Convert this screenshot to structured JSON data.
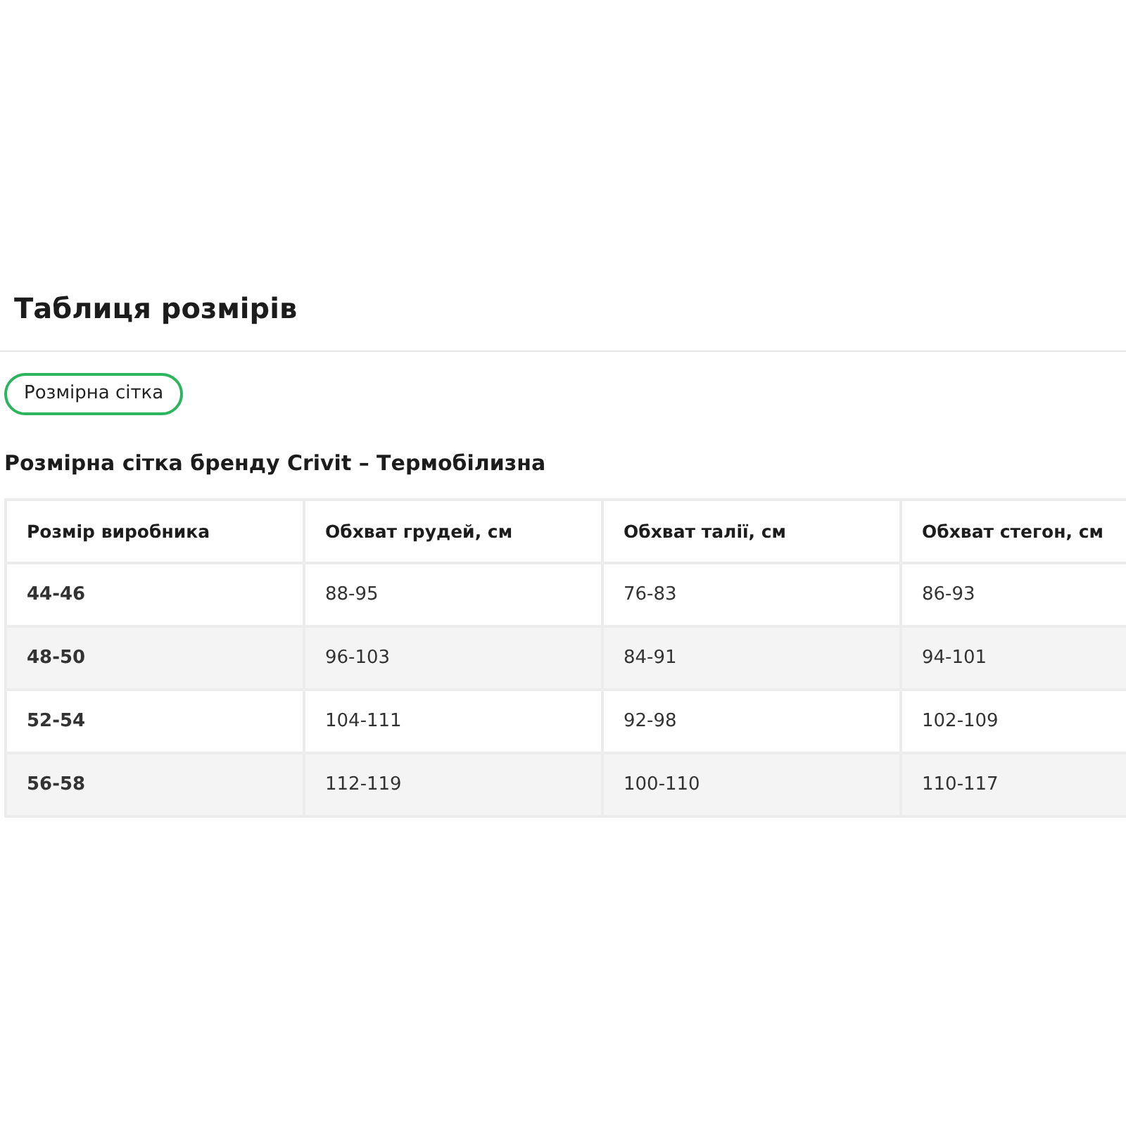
{
  "title": "Таблиця розмірів",
  "tabs": [
    {
      "label": "Розмірна сітка",
      "selected": true
    }
  ],
  "subtitle": "Розмірна сітка бренду Crivit – Термобілизна",
  "table": {
    "columns": [
      "Розмір виробника",
      "Обхват грудей, см",
      "Обхват талії, см",
      "Обхват стегон, см"
    ],
    "rows": [
      [
        "44-46",
        "88-95",
        "76-83",
        "86-93"
      ],
      [
        "48-50",
        "96-103",
        "84-91",
        "94-101"
      ],
      [
        "52-54",
        "104-111",
        "92-98",
        "102-109"
      ],
      [
        "56-58",
        "112-119",
        "100-110",
        "110-117"
      ]
    ]
  }
}
